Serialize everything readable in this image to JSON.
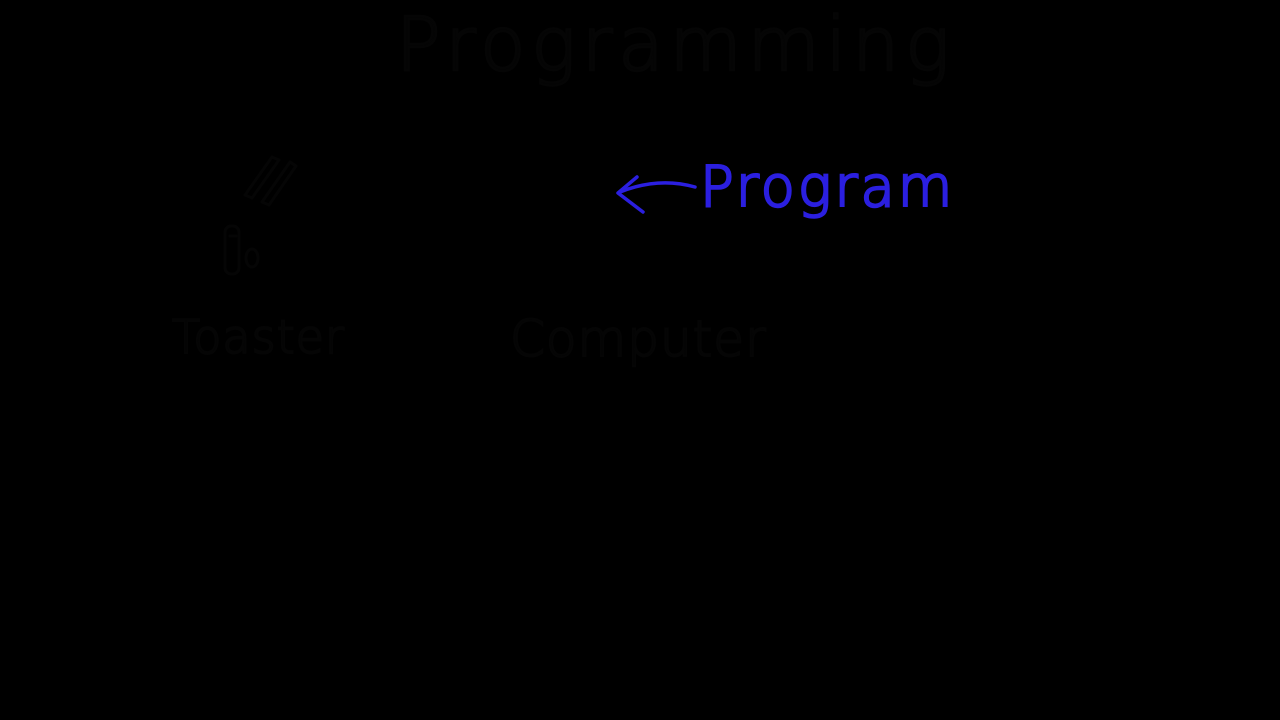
{
  "whiteboard": {
    "title": "Programming",
    "labels": {
      "toaster": "Toaster",
      "computer": "Computer",
      "program": "Program"
    },
    "icons": {
      "toaster": "toaster-sketch-icon",
      "arrow": "left-arrow-icon"
    },
    "colors": {
      "background": "#000000",
      "ink_dark": "#050505",
      "ink_blue": "#2b1fe0"
    }
  }
}
